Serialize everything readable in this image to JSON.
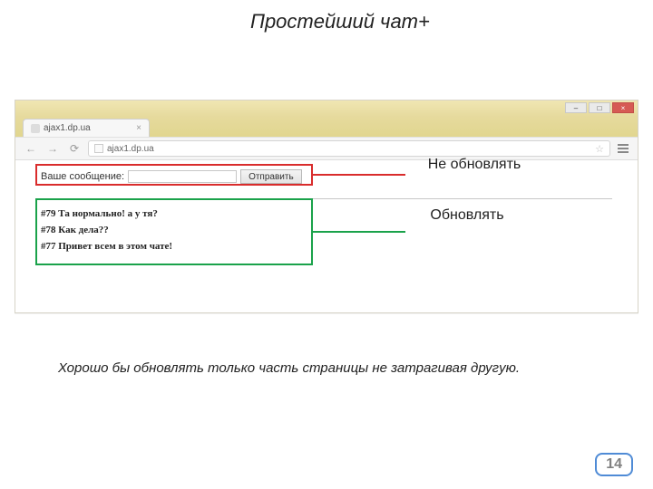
{
  "slide": {
    "title": "Простейший чат+",
    "caption": "Хорошо бы обновлять только часть страницы не затрагивая другую.",
    "page_number": "14"
  },
  "annotations": {
    "no_refresh": "Не обновлять",
    "refresh": "Обновлять"
  },
  "browser": {
    "tab_title": "ajax1.dp.ua",
    "tab_close": "×",
    "url": "ajax1.dp.ua",
    "win": {
      "min": "–",
      "max": "□",
      "close": "×"
    },
    "nav": {
      "back": "←",
      "fwd": "→",
      "reload": "⟳"
    },
    "star": "☆"
  },
  "chat": {
    "label": "Ваше сообщение:",
    "send": "Отправить",
    "messages": [
      "#79 Та нормально! а у тя?",
      "#78 Как дела??",
      "#77 Привет всем в этом чате!"
    ]
  }
}
